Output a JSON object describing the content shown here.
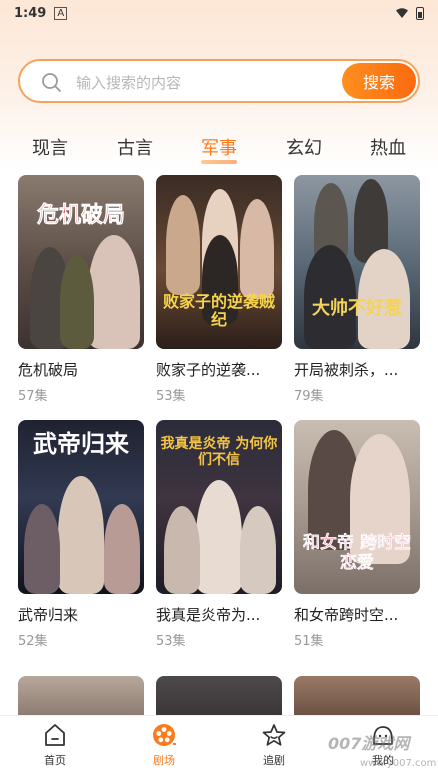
{
  "status_bar": {
    "time": "1:49",
    "indicator": "A"
  },
  "search": {
    "placeholder": "输入搜索的内容",
    "button_label": "搜索"
  },
  "tabs": [
    {
      "label": "现言",
      "active": false
    },
    {
      "label": "古言",
      "active": false
    },
    {
      "label": "军事",
      "active": true
    },
    {
      "label": "玄幻",
      "active": false
    },
    {
      "label": "热血",
      "active": false
    }
  ],
  "dramas": [
    {
      "title": "危机破局",
      "episodes": "57集",
      "poster_text": "危机破局",
      "poster_color": "#6b5a52",
      "title_color": "#c0161a"
    },
    {
      "title": "败家子的逆袭...",
      "episodes": "53集",
      "poster_text": "败家子的逆袭贼纪",
      "poster_color": "#4a3a2e",
      "title_color": "#f7d44a"
    },
    {
      "title": "开局被刺杀，...",
      "episodes": "79集",
      "poster_text": "大帅不好惹",
      "poster_color": "#5b6a78",
      "title_color": "#f4d35a"
    },
    {
      "title": "武帝归来",
      "episodes": "52集",
      "poster_text": "武帝归来",
      "poster_color": "#2c3140",
      "title_color": "#ffffff"
    },
    {
      "title": "我真是炎帝为...",
      "episodes": "53集",
      "poster_text": "我真是炎帝 为何你们不信",
      "poster_color": "#2a2c3a",
      "title_color": "#f6c445"
    },
    {
      "title": "和女帝跨时空...",
      "episodes": "51集",
      "poster_text": "和女帝 跨时空恋爱",
      "poster_color": "#b5a79c",
      "title_color": "#e23b7a"
    }
  ],
  "bottom_nav": [
    {
      "label": "首页",
      "icon": "home-icon",
      "active": false
    },
    {
      "label": "剧场",
      "icon": "film-reel-icon",
      "active": true
    },
    {
      "label": "追剧",
      "icon": "star-icon",
      "active": false
    },
    {
      "label": "我的",
      "icon": "profile-icon",
      "active": false
    }
  ],
  "watermark": {
    "text": "007游戏网",
    "url": "www.y007.com"
  },
  "colors": {
    "accent": "#ff7a1a",
    "search_border": "#f6a25a",
    "muted": "#999999"
  }
}
